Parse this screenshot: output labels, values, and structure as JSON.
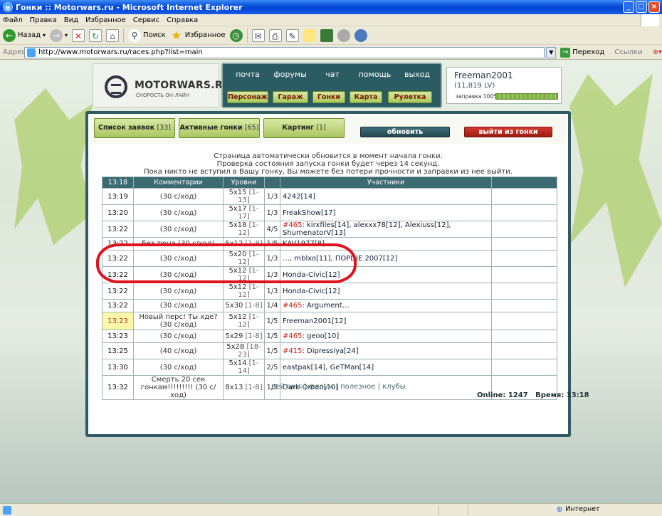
{
  "window": {
    "title": "Гонки :: Motorwars.ru - Microsoft Internet Explorer"
  },
  "menu": [
    "Файл",
    "Правка",
    "Вид",
    "Избранное",
    "Сервис",
    "Справка"
  ],
  "toolbar": {
    "back": "Назад",
    "search": "Поиск",
    "favorites": "Избранное"
  },
  "address": {
    "label": "Адрес:",
    "url": "http://www.motorwars.ru/races.php?list=main",
    "go": "Переход",
    "links": "Ссылки"
  },
  "site": {
    "logo": "MOTORWARS.RU",
    "tagline": "СКОРОСТЬ ОН-ЛАЙН",
    "nav_top": [
      "почта",
      "форумы",
      "чат",
      "помощь",
      "выход"
    ],
    "nav_main": [
      "Персонаж",
      "Гараж",
      "Гонки",
      "Карта",
      "Рулетка"
    ],
    "user": {
      "name": "Freeman2001",
      "money": "(11,819 LV)",
      "fuel_label": "заправка 100%",
      "fuel_level": 1.0
    }
  },
  "tabs": [
    {
      "label": "Список заявок",
      "count": "[33]"
    },
    {
      "label": "Активные гонки",
      "count": "[65]"
    },
    {
      "label": "Картинг",
      "count": "[1]"
    }
  ],
  "actions": {
    "refresh": "обновить",
    "leave": "выйти из гонки"
  },
  "info": [
    "Страница автоматически обновится в момент начала гонки.",
    "Проверка состояния запуска гонки будет через 14 секунд.",
    "Пока никто не вступил в Вашу гонку, Вы можете без потери прочности и заправки из нее выйти."
  ],
  "table": {
    "headers": [
      "13:18",
      "Комментарии",
      "Уровни",
      "",
      "Участники",
      ""
    ],
    "rows": [
      {
        "time": "13:19",
        "comment": "(30 с/ход)",
        "level": "5x15",
        "range": "[1-13]",
        "slots": "1/3",
        "club": "",
        "users": "4242[14]"
      },
      {
        "time": "13:20",
        "comment": "(30 с/ход)",
        "level": "5x17",
        "range": "[1-17]",
        "slots": "1/3",
        "club": "",
        "users": "FreakShow[17]"
      },
      {
        "time": "13:22",
        "comment": "(30 с/ход)",
        "level": "5x18",
        "range": "[1-12]",
        "slots": "4/5",
        "club": "#465",
        "users": ": kirxfiles[14], alexxx78[12], Alexiuss[12], ShumenatorV[13]"
      },
      {
        "time": "13:22",
        "comment": "без тюна (30 с/ход)",
        "level": "5x12",
        "range": "[1-8]",
        "slots": "1/5",
        "club": "",
        "users": "KAV1977[8]"
      },
      {
        "time": "13:22",
        "comment": "(30 с/ход)",
        "level": "5x20",
        "range": "[1-12]",
        "slots": "1/3",
        "club": "",
        "users": "…, mblxo[11], ПОРШЕ 2007[12]"
      },
      {
        "time": "13:22",
        "comment": "(30 с/ход)",
        "level": "5x12",
        "range": "[1-12]",
        "slots": "1/3",
        "club": "",
        "users": "Honda-Civic[12]"
      },
      {
        "time": "13:22",
        "comment": "(30 с/ход)",
        "level": "5x12",
        "range": "[1-12]",
        "slots": "1/3",
        "club": "",
        "users": "Honda-Civic[12]"
      },
      {
        "time": "13:22",
        "comment": "(30 с/ход)",
        "level": "5x30",
        "range": "[1-8]",
        "slots": "1/4",
        "club": "#465",
        "users": ": Argument…"
      },
      {
        "time": "13:23",
        "comment": "Новый перс! Ты хде? (30 с/ход)",
        "level": "5x12",
        "range": "[1-12]",
        "slots": "1/5",
        "club": "",
        "users": "Freeman2001[12]",
        "mine": true
      },
      {
        "time": "13:23",
        "comment": "(30 с/ход)",
        "level": "5x29",
        "range": "[1-8]",
        "slots": "1/5",
        "club": "#465",
        "users": ": geoo[10]"
      },
      {
        "time": "13:25",
        "comment": "(40 с/ход)",
        "level": "5x28",
        "range": "[18-23]",
        "slots": "1/5",
        "club": "#415",
        "users": ": Dipressiya[24]"
      },
      {
        "time": "13:30",
        "comment": "(30 с/ход)",
        "level": "5x14",
        "range": "[1-14]",
        "slots": "2/5",
        "club": "",
        "users": "eastpak[14], GeTMan[14]"
      },
      {
        "time": "13:32",
        "comment": "Смерть 20 сек гонкам!!!!!!!!! (30 с/ход)",
        "level": "8x13",
        "range": "[1-8]",
        "slots": "1/5",
        "club": "",
        "users": "Dark-Omen[10]"
      }
    ]
  },
  "footer": {
    "links": [
      "рейтинг",
      "форум",
      "полезное",
      "клубы"
    ],
    "online": "Online: 1247",
    "time": "Время: 13:18"
  },
  "status": {
    "zone": "Интернет"
  }
}
